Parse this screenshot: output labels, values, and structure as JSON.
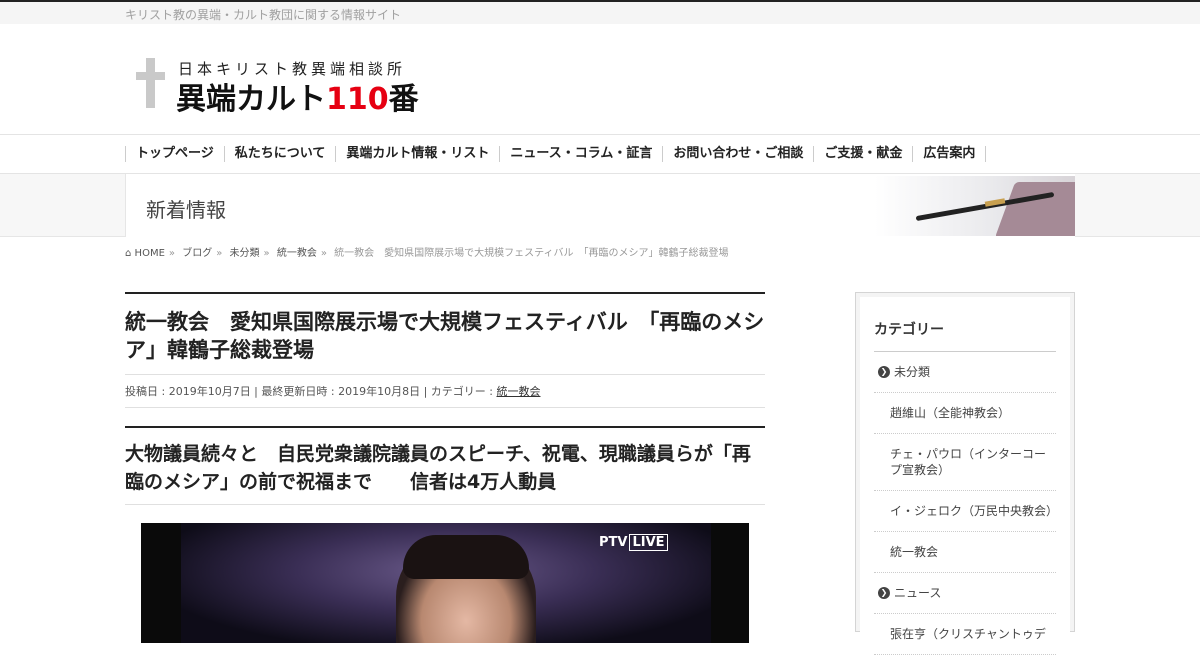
{
  "site": {
    "tagline": "キリスト教の異端・カルト教団に関する情報サイト",
    "logo_sub": "日本キリスト教異端相談所",
    "logo_main_pre": "異端カルト",
    "logo_main_num": "110",
    "logo_main_post": "番"
  },
  "nav": {
    "items": [
      {
        "label": "トップページ"
      },
      {
        "label": "私たちについて"
      },
      {
        "label": "異端カルト情報・リスト"
      },
      {
        "label": "ニュース・コラム・証言"
      },
      {
        "label": "お問い合わせ・ご相談"
      },
      {
        "label": "ご支援・献金"
      },
      {
        "label": "広告案内"
      }
    ]
  },
  "band": {
    "heading": "新着情報"
  },
  "breadcrumb": {
    "home": "HOME",
    "items": [
      "ブログ",
      "未分類",
      "統一教会",
      "統一教会　愛知県国際展示場で大規模フェスティバル　「再臨のメシア」韓鶴子総裁登場"
    ]
  },
  "post": {
    "title": "統一教会　愛知県国際展示場で大規模フェスティバル　「再臨のメシア」韓鶴子総裁登場",
    "meta_prefix": "投稿日 : 2019年10月7日 | 最終更新日時 : 2019年10月8日 | カテゴリー : ",
    "meta_category": "統一教会",
    "subheading": "大物議員続々と　自民党衆議院議員のスピーチ、祝電、現職議員らが「再臨のメシア」の前で祝福まで　　信者は4万人動員",
    "video_logo": "PTV",
    "video_live": "LIVE"
  },
  "sidebar": {
    "title": "カテゴリー",
    "items": [
      {
        "label": "未分類",
        "bullet": true
      },
      {
        "label": "趙維山（全能神教会）",
        "bullet": false
      },
      {
        "label": "チェ・パウロ（インターコープ宣教会）",
        "bullet": false
      },
      {
        "label": "イ・ジェロク（万民中央教会）",
        "bullet": false
      },
      {
        "label": "統一教会",
        "bullet": false
      },
      {
        "label": "ニュース",
        "bullet": true
      },
      {
        "label": "張在亨（クリスチャントゥデ",
        "bullet": false
      }
    ]
  },
  "colors": {
    "accent_red": "#e60012",
    "cross_gray": "#c9c9c9"
  }
}
